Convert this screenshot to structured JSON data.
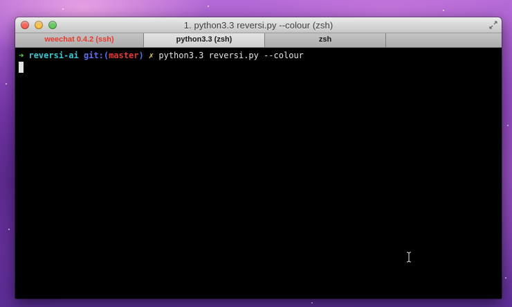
{
  "window": {
    "title": "1. python3.3 reversi.py --colour (zsh)"
  },
  "tabs": [
    {
      "label": "weechat 0.4.2 (ssh)",
      "active": false,
      "color": "#e8392f"
    },
    {
      "label": "python3.3 (zsh)",
      "active": true
    },
    {
      "label": "zsh",
      "active": false
    },
    {
      "label": "",
      "active": false
    }
  ],
  "terminal": {
    "prompt": {
      "arrow": "➜",
      "directory": "reversi-ai",
      "git_prefix": "git:(",
      "branch": "master",
      "git_suffix": ")",
      "dirty_mark": "✗",
      "command": "python3.3 reversi.py --colour"
    },
    "colors": {
      "arrow": "#5fdd3a",
      "directory": "#35c9d6",
      "git": "#5d6ef0",
      "branch": "#e8392f",
      "dirty": "#f2d43a",
      "background": "#000000"
    }
  },
  "icons": {
    "close": "close-icon",
    "minimize": "minimize-icon",
    "maximize": "maximize-icon",
    "resize": "fullscreen-arrows-icon",
    "text_cursor": "i-beam-cursor-icon"
  }
}
